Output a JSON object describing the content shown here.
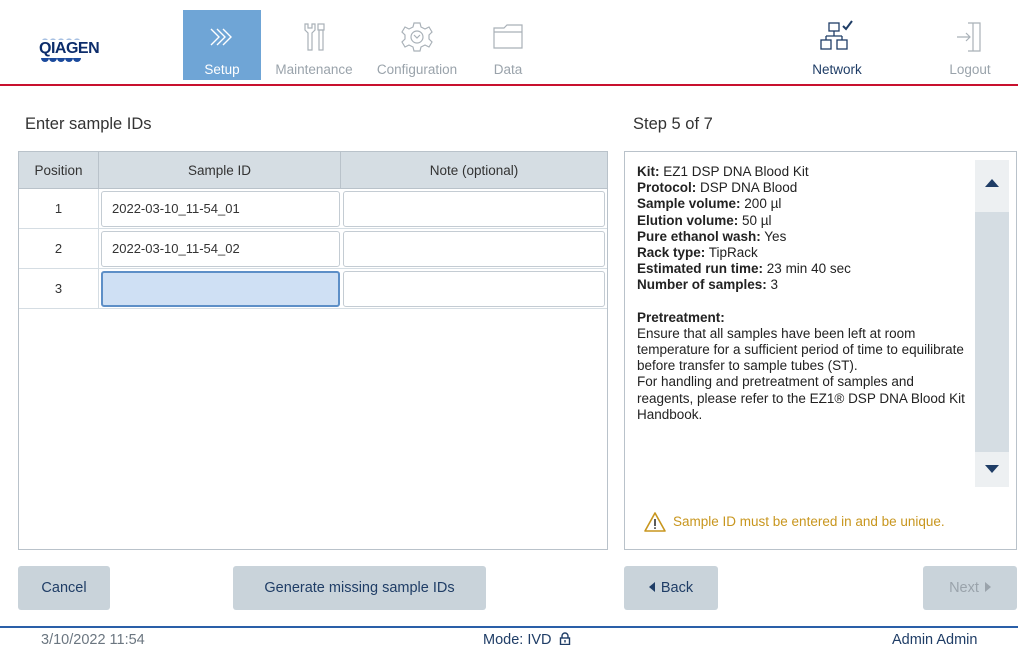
{
  "header": {
    "logo_text": "QIAGEN",
    "nav": [
      {
        "label": "Setup",
        "icon": "setup-chevrons-icon",
        "active": true
      },
      {
        "label": "Maintenance",
        "icon": "wrench-screwdriver-icon",
        "active": false
      },
      {
        "label": "Configuration",
        "icon": "gear-icon",
        "active": false
      },
      {
        "label": "Data",
        "icon": "folder-icon",
        "active": false
      }
    ],
    "network": {
      "label": "Network",
      "icon": "network-check-icon"
    },
    "logout": {
      "label": "Logout",
      "icon": "logout-icon"
    }
  },
  "left": {
    "title": "Enter sample IDs",
    "columns": [
      "Position",
      "Sample ID",
      "Note (optional)"
    ],
    "rows": [
      {
        "position": "1",
        "sample_id": "2022-03-10_11-54_01",
        "note": ""
      },
      {
        "position": "2",
        "sample_id": "2022-03-10_11-54_02",
        "note": ""
      },
      {
        "position": "3",
        "sample_id": "",
        "note": ""
      }
    ]
  },
  "right": {
    "step": "Step 5 of 7",
    "kit_label": "Kit:",
    "kit_value": "EZ1 DSP DNA Blood Kit",
    "protocol_label": "Protocol:",
    "protocol_value": "DSP DNA Blood",
    "sample_volume_label": "Sample volume:",
    "sample_volume_value": "200 µl",
    "elution_volume_label": "Elution volume:",
    "elution_volume_value": "50 µl",
    "ethanol_label": "Pure ethanol wash:",
    "ethanol_value": "Yes",
    "rack_label": "Rack type:",
    "rack_value": "TipRack",
    "runtime_label": "Estimated run time:",
    "runtime_value": "23 min 40 sec",
    "num_samples_label": "Number of samples:",
    "num_samples_value": "3",
    "pretreatment_label": "Pretreatment:",
    "pretreatment_text_1": "Ensure that all samples have been left at room temperature for a sufficient period of time to equilibrate before transfer to sample tubes (ST).",
    "pretreatment_text_2": "For handling and pretreatment of samples and reagents, please refer to the EZ1® DSP DNA Blood Kit Handbook.",
    "warning": "Sample ID must be entered in and be unique."
  },
  "buttons": {
    "cancel": "Cancel",
    "generate": "Generate missing sample IDs",
    "back": "Back",
    "next": "Next"
  },
  "footer": {
    "datetime": "3/10/2022 11:54",
    "mode": "Mode: IVD",
    "user": "Admin Admin"
  },
  "colors": {
    "accent_red": "#c8102e",
    "active_blue": "#6fa5d6",
    "navy": "#1f3d66",
    "warning": "#c8961e"
  }
}
